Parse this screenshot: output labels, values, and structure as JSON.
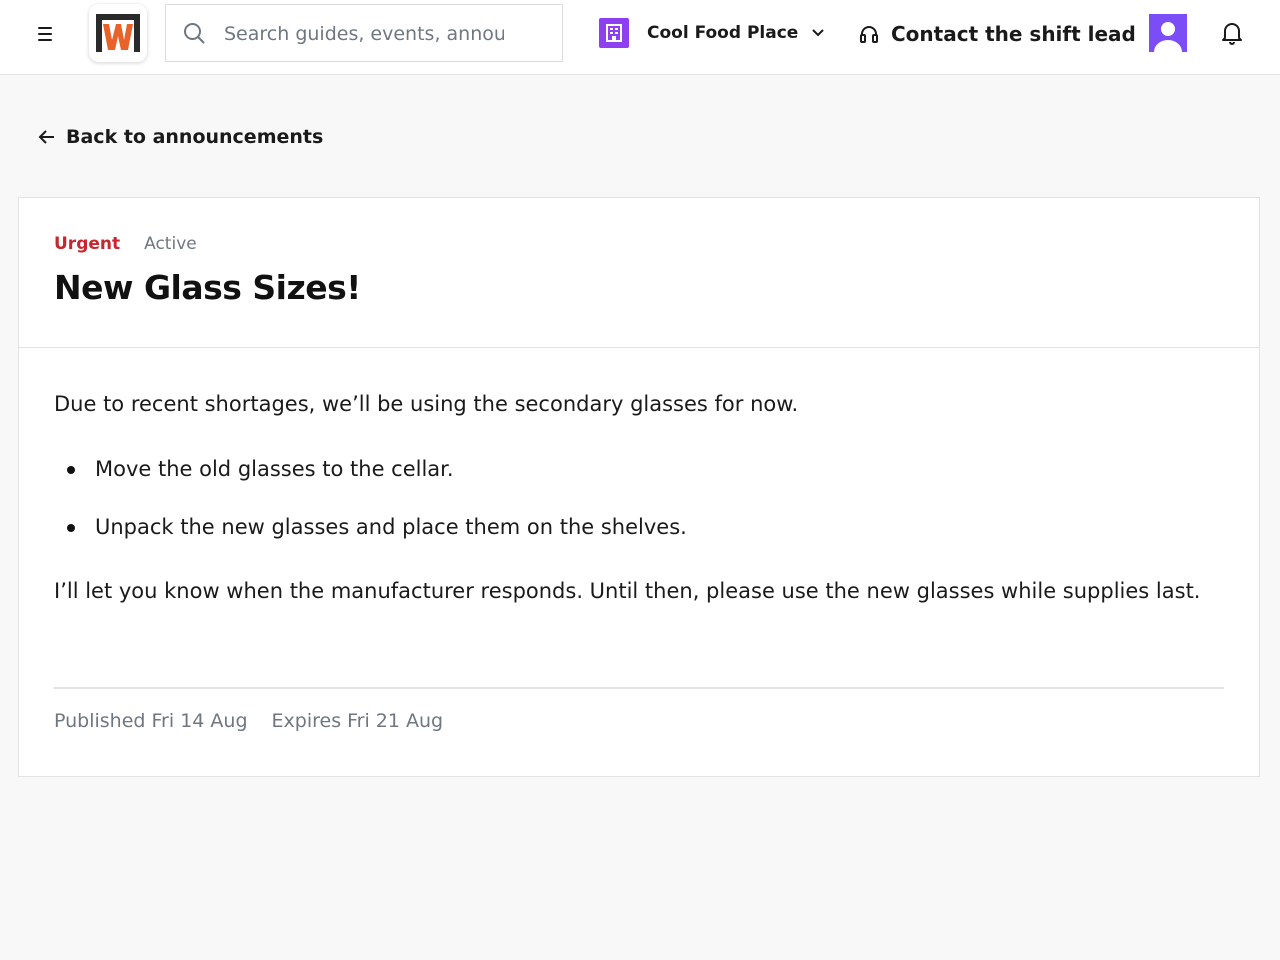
{
  "header": {
    "menu_icon": "hamburger-menu-icon",
    "logo_icon": "wl-logo",
    "search": {
      "placeholder": "Search guides, events, announcements",
      "value": ""
    },
    "location": {
      "name": "Cool Food Place",
      "icon": "building-icon",
      "badge_color": "#8e3ff0"
    },
    "contact": {
      "label": "Contact the shift lead",
      "icon": "headset-icon"
    },
    "avatar": {
      "icon": "user-avatar-icon",
      "color": "#7b4df6"
    },
    "notifications_icon": "bell-icon"
  },
  "back_link": {
    "label": "Back to announcements",
    "icon": "arrow-left-icon"
  },
  "announcement": {
    "tags": {
      "urgent": "Urgent",
      "status": "Active"
    },
    "title": "New Glass Sizes!",
    "intro": "Due to recent shortages, we’ll be using the secondary glasses for now.",
    "steps": [
      "Move the old glasses to the cellar.",
      "Unpack the new glasses and place them on the shelves."
    ],
    "closing": "I’ll let you know when the manufacturer responds. Until then, please use the new glasses while supplies last.",
    "published": "Published Fri 14 Aug",
    "expires": "Expires Fri 21 Aug"
  },
  "colors": {
    "urgent": "#c8262e",
    "muted": "#6f7780",
    "accent": "#8e3ff0"
  }
}
